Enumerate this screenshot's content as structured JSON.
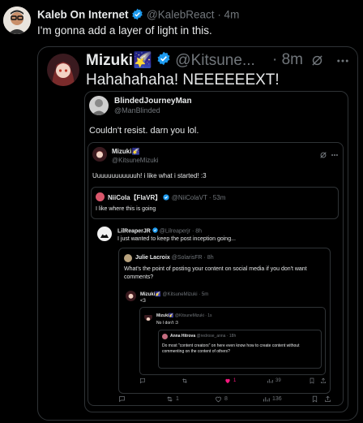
{
  "tweet": {
    "name": "Kaleb On Internet",
    "handle": "@KalebReact",
    "time": "· 4m",
    "text": "I'm gonna add a layer of light in this."
  },
  "quote1": {
    "name": "Mizuki🌠",
    "handle": "@Kitsune...",
    "time": "· 8m",
    "text": "Hahahahaha! NEEEEEEXT!"
  },
  "quote2": {
    "name": "BlindedJourneyMan",
    "handle": "@ManBlinded",
    "text": "Couldn't resist. darn you lol."
  },
  "quote3": {
    "name": "Mizuki🌠",
    "handle": "@KitsuneMizuki",
    "text": "Uuuuuuuuuuuuh! i like what i started! :3"
  },
  "quote4": {
    "name": "NiiCola【FlaVR】",
    "handle": "@NiiColaVT · 53m",
    "text": "I like where this is going"
  },
  "reply1": {
    "name": "LilReaperJR",
    "handle": "@Lilreaperjr · 8h",
    "text": "I just wanted to keep the post inception going..."
  },
  "quote5": {
    "name": "Julie Lacroix",
    "handle": "@SolarisFR · 8h",
    "text": "What's the point of posting your content on social media if you don't want comments?"
  },
  "reply2": {
    "name": "Mizuki🌠",
    "handle": "@KitsuneMizuki · 5m",
    "text": "<3"
  },
  "quote6": {
    "name": "Mizuki🌠",
    "handle": "@KitsuneMizuki · 1s",
    "text": "No I don't :3"
  },
  "quote7": {
    "name": "Anna Hitrova",
    "handle": "@redrose_anna · 18h",
    "text": "Do most \"content creators\" on here even know how to create content without commenting on the content of others?"
  },
  "inner_actions": {
    "replies": "",
    "reposts": "",
    "likes": "1",
    "views": "39"
  },
  "outer_actions": {
    "replies": "",
    "reposts": "1",
    "likes": "8",
    "views": "136"
  },
  "colors": {
    "verified": "#1d9bf0",
    "like_active": "#f91880",
    "muted": "#71767b",
    "border": "#2f3336"
  }
}
